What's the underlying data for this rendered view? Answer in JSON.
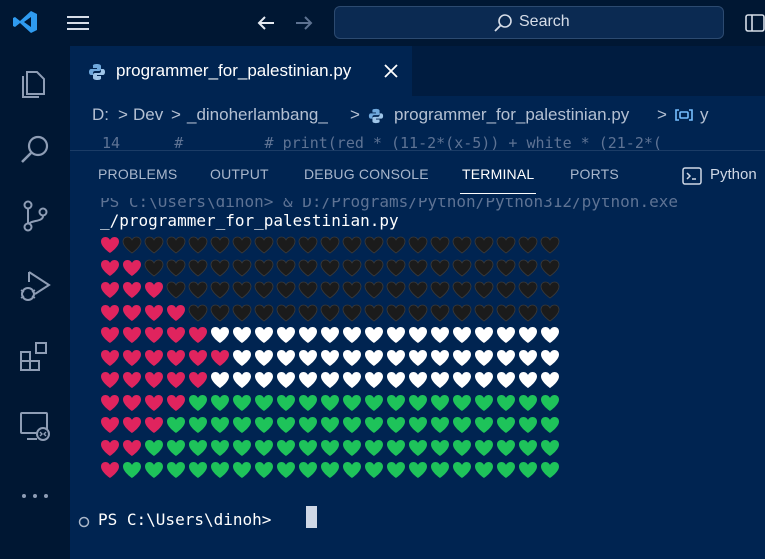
{
  "titlebar": {
    "search_label": "Search"
  },
  "icons": {
    "vscode": "vscode-logo",
    "menu": "hamburger-menu-icon",
    "back": "arrow-left-icon",
    "forward": "arrow-right-icon",
    "search": "search-icon",
    "layout": "layout-icon"
  },
  "activity": [
    "explorer-icon",
    "search-icon",
    "source-control-icon",
    "run-debug-icon",
    "extensions-icon",
    "remote-explorer-icon",
    "more-icon"
  ],
  "tab": {
    "label": "programmer_for_palestinian.py"
  },
  "breadcrumb": {
    "items": [
      "D:",
      "Dev",
      "_dinoherlambang_",
      "programmer_for_palestinian.py",
      "y"
    ],
    "separator": ">"
  },
  "editor": {
    "ghost_line": "14      #         # print(red * (11-2*(x-5)) + white * (21-2*("
  },
  "panel": {
    "tabs": [
      "PROBLEMS",
      "OUTPUT",
      "DEBUG CONSOLE",
      "TERMINAL",
      "PORTS"
    ],
    "active_tab": "TERMINAL",
    "terminal_label": "Python"
  },
  "terminal": {
    "ghost_line": "PS C:\\Users\\dinoh> & D:/Programs/Python/Python312/python.exe",
    "path_line": "_/programmer_for_palestinian.py",
    "rows": [
      {
        "red": 1,
        "white": 0,
        "green": 0,
        "black": 20
      },
      {
        "red": 2,
        "white": 0,
        "green": 0,
        "black": 19
      },
      {
        "red": 3,
        "white": 0,
        "green": 0,
        "black": 18
      },
      {
        "red": 4,
        "white": 0,
        "green": 0,
        "black": 17
      },
      {
        "red": 5,
        "white": 16,
        "green": 0,
        "black": 0
      },
      {
        "red": 6,
        "white": 15,
        "green": 0,
        "black": 0
      },
      {
        "red": 5,
        "white": 16,
        "green": 0,
        "black": 0
      },
      {
        "red": 4,
        "white": 0,
        "green": 17,
        "black": 0
      },
      {
        "red": 3,
        "white": 0,
        "green": 18,
        "black": 0
      },
      {
        "red": 2,
        "white": 0,
        "green": 19,
        "black": 0
      },
      {
        "red": 1,
        "white": 0,
        "green": 20,
        "black": 0
      }
    ],
    "heart_colors": {
      "red": "#e0245e",
      "black": "#1b1b1b",
      "white": "#ffffff",
      "green": "#1ec35a"
    },
    "prompt": "PS C:\\Users\\dinoh> "
  },
  "colors": {
    "background": "#002451",
    "titlebar": "#001733",
    "accent": "#1e90ff"
  }
}
